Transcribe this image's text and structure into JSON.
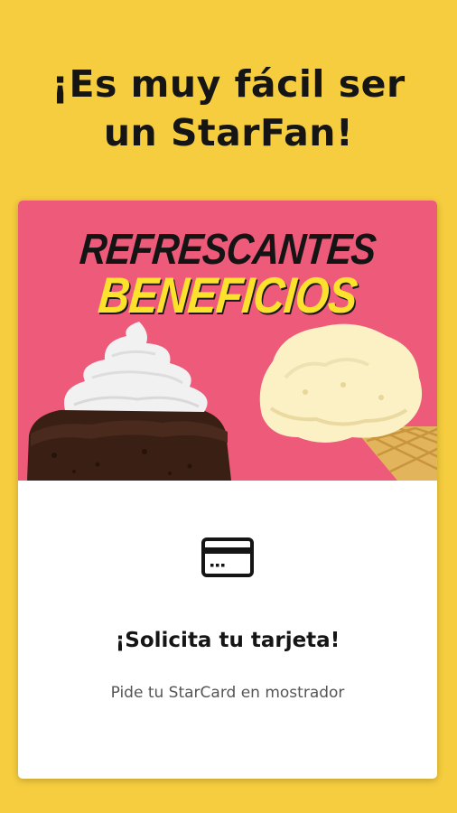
{
  "headline": {
    "line1": "¡Es muy fácil ser",
    "line2": "un StarFan!"
  },
  "promo_card": {
    "banner": {
      "line1": "REFRESCANTES",
      "line2": "BENEFICIOS"
    },
    "icon": "credit-card-icon",
    "title": "¡Solicita tu tarjeta!",
    "subtitle": "Pide tu StarCard en mostrador"
  },
  "colors": {
    "background": "#F6CD3E",
    "banner_background": "#EE5A7A",
    "banner_accent": "#FCE22C",
    "text_dark": "#151515",
    "text_muted": "#555555",
    "card_background": "#FFFFFF"
  }
}
